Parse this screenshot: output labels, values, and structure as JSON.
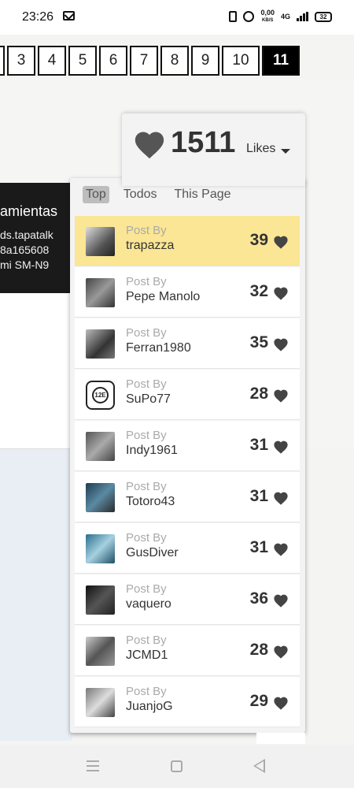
{
  "status_bar": {
    "time": "23:26",
    "speed_value": "0,00",
    "speed_unit": "KB/S",
    "network": "4G",
    "battery": "32"
  },
  "pagination": {
    "pages": [
      "3",
      "4",
      "5",
      "6",
      "7",
      "8",
      "9",
      "10",
      "11"
    ],
    "active": "11"
  },
  "background": {
    "tooltip_title": "amientas",
    "tooltip_lines": [
      "ds.tapatalk",
      "8a165608",
      "mi SM-N9"
    ]
  },
  "likes_popup": {
    "count": "1511",
    "label": "Likes",
    "tabs": [
      "Top",
      "Todos",
      "This Page"
    ],
    "active_tab": "Top",
    "post_by_label": "Post By",
    "entries": [
      {
        "user": "trapazza",
        "score": "39",
        "avatar_icon": "avatar-chaplin",
        "highlight": true
      },
      {
        "user": "Pepe Manolo",
        "score": "32",
        "avatar_icon": "avatar-watch"
      },
      {
        "user": "Ferran1980",
        "score": "35",
        "avatar_icon": "avatar-portrait"
      },
      {
        "user": "SuPo77",
        "score": "28",
        "avatar_icon": "avatar-12e-watch",
        "avatar_text": "12E"
      },
      {
        "user": "Indy1961",
        "score": "31",
        "avatar_icon": "avatar-clock"
      },
      {
        "user": "Totoro43",
        "score": "31",
        "avatar_icon": "avatar-man"
      },
      {
        "user": "GusDiver",
        "score": "31",
        "avatar_icon": "avatar-shark"
      },
      {
        "user": "vaquero",
        "score": "36",
        "avatar_icon": "avatar-dark-watch"
      },
      {
        "user": "JCMD1",
        "score": "28",
        "avatar_icon": "avatar-person"
      },
      {
        "user": "JuanjoG",
        "score": "29",
        "avatar_icon": "avatar-diver-watch"
      }
    ],
    "highlight_color": "#fae694"
  }
}
